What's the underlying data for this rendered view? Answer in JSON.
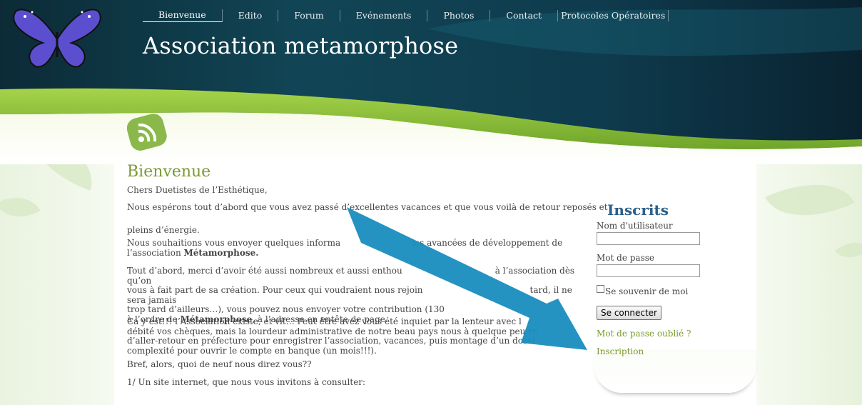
{
  "nav": {
    "items": [
      "Bienvenue",
      "Edito",
      "Forum",
      "Evénements",
      "Photos",
      "Contact",
      "Protocoles Opératoires"
    ],
    "active": "Bienvenue"
  },
  "site": {
    "title": "Association metamorphose"
  },
  "page": {
    "heading": "Bienvenue",
    "p1": "Chers Duetistes de l’Esthétique,",
    "p2": "Nous espérons tout d’abord que vous avez passé d’excellentes vacances et que vous voilà de retour reposés et",
    "p3": "pleins d’énergie.",
    "p4a": "Nous souhaitions vous envoyer quelques informa",
    "p4b": "les avancées de développement de",
    "p4c": "l’association ",
    "p4d": "Métamorphose.",
    "p5a": "Tout d’abord, merci d’avoir été aussi nombreux et aussi enthou",
    "p5b": "à l’association dès qu’on",
    "p5c": "vous à fait part de sa création. Pour ceux qui voudraient nous rejoin",
    "p5d": "tard, il ne sera jamais",
    "p5e": "trop tard d’ailleurs…), vous pouvez nous envoyer votre contribution (130",
    "p5f": "à l’ordre de ",
    "p5g": "Métamorphose",
    "p5h": ", à l’adresse en entête de page.",
    "p6a": "Ca y est!!! l’Association existe, et vit… Peut être avez vous été inquiet par la lenteur avec l",
    "p6b": "débité vos chèques, mais la lourdeur administrative de notre beau pays nous à quelque peu re",
    "p6c": "d’aller-retour en préfecture pour enregistrer l’association, vacances, puis montage d’un dossi",
    "p6d": "complexité pour ouvrir le compte en banque (un mois!!!).",
    "p7": "Bref, alors, quoi de neuf nous direz vous??",
    "p8": "1/ Un site internet, que nous vous invitons à consulter:"
  },
  "login": {
    "title": "Inscrits",
    "username_label": "Nom d'utilisateur",
    "password_label": "Mot de passe",
    "remember_label": "Se souvenir de moi",
    "submit_label": "Se connecter",
    "forgot_link": "Mot de passe oublié ?",
    "register_link": "Inscription"
  },
  "colors": {
    "header_dark": "#0d2a35",
    "accent_green": "#8cc63f",
    "arrow": "#1c8fbe",
    "link": "#7a9a2a",
    "title_blue": "#2a5f8a"
  },
  "icons": [
    "butterfly-logo",
    "rss-icon",
    "arrow-annotation"
  ]
}
